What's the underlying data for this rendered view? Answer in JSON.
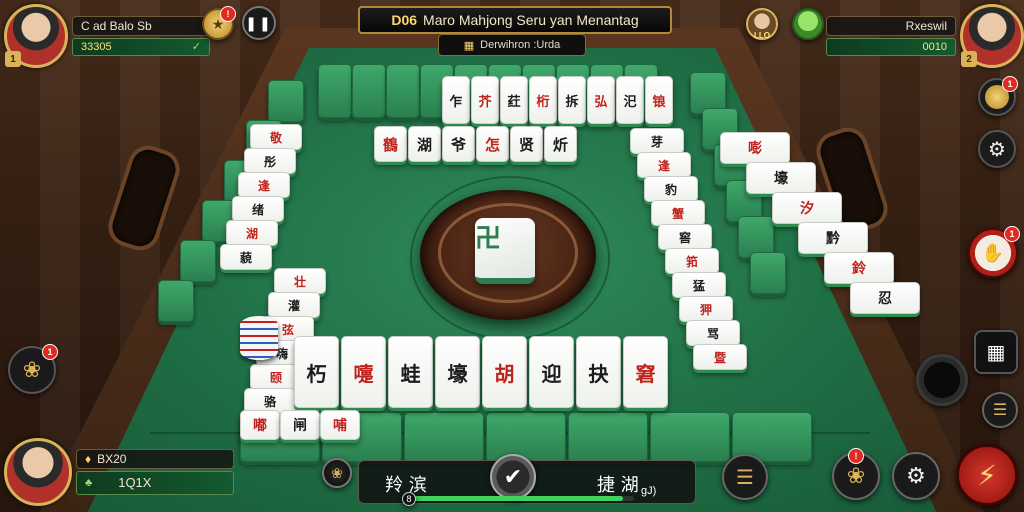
{
  "header": {
    "title_code": "D06",
    "title_text": "Maro Mahjong Seru yan Menantag",
    "subtitle": "Derwihron :Urda"
  },
  "players": {
    "top_left": {
      "name": "C ad Balo Sb",
      "score": "33305",
      "notif": "!"
    },
    "top_right": {
      "name": "Rxeswil",
      "score": "0010"
    },
    "bottom_left": {
      "name": "BX20",
      "score": "1Q1X"
    },
    "top_mid_avatar_label": "LLO",
    "top_left_badge": "1",
    "top_right_badge": "2"
  },
  "hand_panel": {
    "left_glyphs": "羚  滨",
    "right_glyphs": "捷  湖",
    "right_sub": "gJ)",
    "counter": "8",
    "progress": 0.95
  },
  "tiles": {
    "row_top": [
      "乍",
      "芥",
      "荭",
      "桁",
      "拆",
      "弘",
      "汜",
      "锒"
    ],
    "row_second": [
      "鶴",
      "湖",
      "爷",
      "怎",
      "贤",
      "炘"
    ],
    "left_column": [
      "敬",
      "彤",
      "逢",
      "绪",
      "湖",
      "藐",
      "壮",
      "灌",
      "弦",
      "嗨",
      "颐",
      "骆"
    ],
    "right_column": [
      "芽",
      "逢",
      "豹",
      "蟹",
      "窖",
      "筘",
      "猛",
      "狎",
      "骂",
      "暨"
    ],
    "right_outer": [
      "嘭",
      "壕",
      "汐",
      "黔",
      "鈴",
      "忍"
    ],
    "bottom_row": [
      "朽",
      "嚏",
      "蛙",
      "壕",
      "胡",
      "迎",
      "抉",
      "窘"
    ],
    "bottom_front": [
      "嘟",
      "闸",
      "哺"
    ],
    "center_tile": "卍"
  },
  "buttons": {
    "pause": "pause",
    "chat_notif": "1",
    "side_notif": "1",
    "hint_notif": "1"
  },
  "colors": {
    "felt": "#1f6e45",
    "gold": "#d9b25a",
    "action_red": "#c0231e",
    "score_yellow": "#ffe27a"
  }
}
